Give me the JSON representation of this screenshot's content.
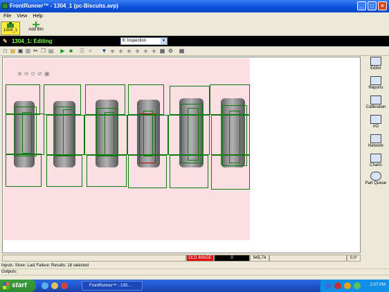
{
  "window": {
    "title": "FrontRunner™ - 1304_1 (pc-Biscuits.avp)",
    "controls": [
      "_",
      "□",
      "×"
    ]
  },
  "menu": [
    "File",
    "View",
    "Help"
  ],
  "toolbar": {
    "camera_label": "1304_1",
    "add_btn_label": "Add Btn"
  },
  "editbar": {
    "status": "1304_1: Editing",
    "inspection_select": "6: Inspection"
  },
  "status": {
    "old_image": "OLD IMAGE",
    "count": "0",
    "coords": "945,74",
    "angle": "0.0°"
  },
  "output_panel": {
    "inputs_line": "Inputs: Store: Last Failure: Results: 18 selected",
    "outputs_line": "Outputs:"
  },
  "right_panel": [
    "Editor",
    "Reports",
    "Calibration",
    "I/O",
    "Network",
    "Charts",
    "Part Queue"
  ],
  "taskbar": {
    "start": "start",
    "task_item": "FrontRunner™ - 130...",
    "clock": "2:07 PM"
  },
  "colors": {
    "editbar_text": "#7cff4a",
    "image_background": "#fcdfe2",
    "roi_box": "#0d7a0d",
    "failed_roi": "#c00000",
    "old_image_badge": "#e01010"
  }
}
